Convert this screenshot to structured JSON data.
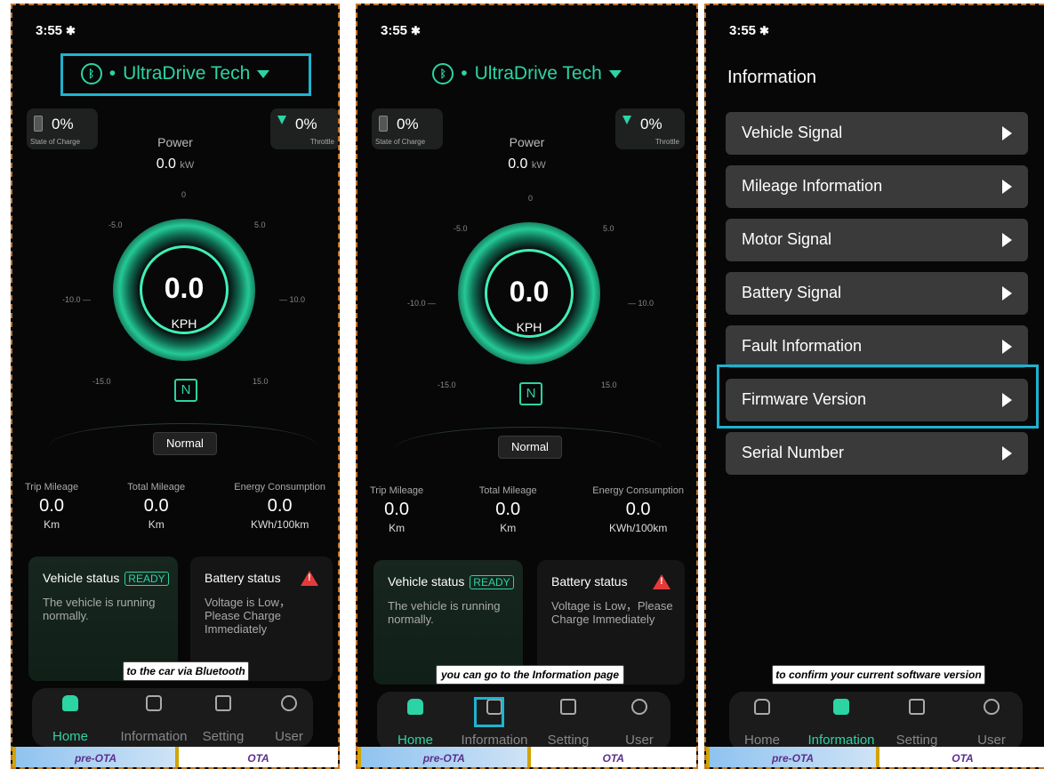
{
  "status_bar": {
    "time": "3:55",
    "bt_glyph": "✱"
  },
  "dashboard": {
    "device_name": "UltraDrive Tech",
    "state_of_charge": {
      "value": "0%",
      "label": "State of Charge"
    },
    "throttle": {
      "value": "0%",
      "label": "Throttle"
    },
    "power": {
      "label": "Power",
      "value": "0.0",
      "unit": "kW"
    },
    "gauge_ticks": {
      "top": "0",
      "upper_left": "-5.0",
      "upper_right": "5.0",
      "mid_left": "-10.0 —",
      "mid_right": "— 10.0",
      "low_left": "-15.0",
      "low_right": "15.0"
    },
    "speed": {
      "value": "0.0",
      "unit": "KPH"
    },
    "gear": "N",
    "mode": "Normal",
    "stats": [
      {
        "label": "Trip Mileage",
        "value": "0.0",
        "unit": "Km"
      },
      {
        "label": "Total Mileage",
        "value": "0.0",
        "unit": "Km"
      },
      {
        "label": "Energy Consumption",
        "value": "0.0",
        "unit": "KWh/100km"
      }
    ],
    "vehicle_status": {
      "title": "Vehicle status",
      "badge": "READY",
      "desc": "The vehicle is running normally."
    },
    "battery_status": {
      "title": "Battery status",
      "desc": "Voltage is Low，Please Charge Immediately"
    }
  },
  "nav": {
    "home": "Home",
    "information": "Information",
    "setting": "Setting",
    "user": "User"
  },
  "callouts": {
    "p1": "to the car via Bluetooth",
    "p2": "you can go to the Information page",
    "p3": "to confirm your current software version"
  },
  "strip": {
    "pre": "pre-OTA",
    "ota": "OTA"
  },
  "information": {
    "title": "Information",
    "items": [
      "Vehicle Signal",
      "Mileage Information",
      "Motor Signal",
      "Battery Signal",
      "Fault Information",
      "Firmware Version",
      "Serial Number"
    ]
  },
  "colors": {
    "accent": "#2cd4a4",
    "highlight": "#1fb3cf",
    "warning": "#e53a3a"
  }
}
